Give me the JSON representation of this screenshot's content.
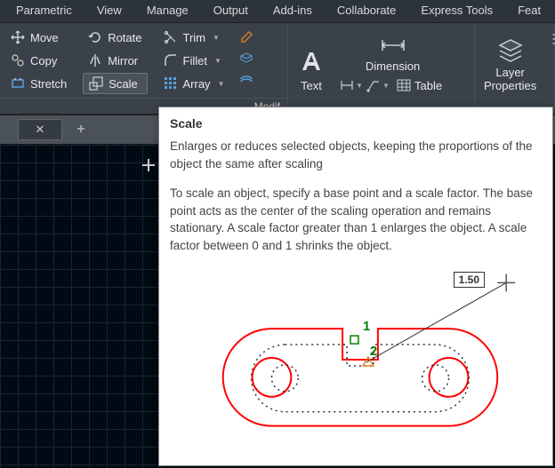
{
  "tabs": {
    "parametric": "Parametric",
    "view": "View",
    "manage": "Manage",
    "output": "Output",
    "addins": "Add-ins",
    "collaborate": "Collaborate",
    "express": "Express Tools",
    "feat": "Feat"
  },
  "modify": {
    "move": "Move",
    "rotate": "Rotate",
    "trim": "Trim",
    "copy": "Copy",
    "mirror": "Mirror",
    "fillet": "Fillet",
    "stretch": "Stretch",
    "scale": "Scale",
    "array": "Array",
    "panel_label": "Modif"
  },
  "annotation": {
    "text": "Text",
    "dimension": "Dimension",
    "table": "Table"
  },
  "layers": {
    "label": "Layer",
    "properties": "Properties"
  },
  "tooltip": {
    "title": "Scale",
    "p1": "Enlarges or reduces selected objects, keeping the proportions of the object the same after scaling",
    "p2": "To scale an object, specify a base point and a scale factor. The base point acts as the center of the scaling operation and remains stationary. A scale factor greater than 1 enlarges the object. A scale factor between 0 and 1 shrinks the object.",
    "scale_value": "1.50",
    "step1": "1",
    "step2": "2"
  }
}
